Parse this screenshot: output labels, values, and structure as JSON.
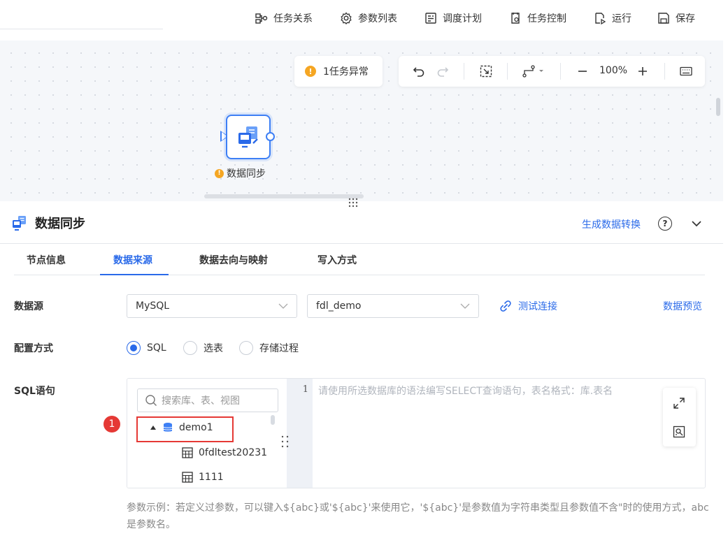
{
  "toolbar": {
    "items": [
      {
        "label": "任务关系",
        "icon": "relation-icon"
      },
      {
        "label": "参数列表",
        "icon": "gear-icon"
      },
      {
        "label": "调度计划",
        "icon": "schedule-icon"
      },
      {
        "label": "任务控制",
        "icon": "task-control-icon"
      },
      {
        "label": "运行",
        "icon": "run-icon"
      },
      {
        "label": "保存",
        "icon": "save-icon"
      }
    ]
  },
  "canvas": {
    "warning_text": "1任务异常",
    "zoom": "100%",
    "node": {
      "label": "数据同步",
      "status": "warning"
    }
  },
  "panel": {
    "title": "数据同步",
    "generate_link": "生成数据转换",
    "tabs": [
      "节点信息",
      "数据来源",
      "数据去向与映射",
      "写入方式"
    ],
    "active_tab": 1
  },
  "form": {
    "datasource_label": "数据源",
    "datasource_type": "MySQL",
    "datasource_conn": "fdl_demo",
    "test_link": "测试连接",
    "preview_link": "数据预览",
    "config_label": "配置方式",
    "config_options": [
      "SQL",
      "选表",
      "存储过程"
    ],
    "config_selected": 0,
    "sql_label": "SQL语句",
    "search_placeholder": "搜索库、表、视图",
    "tree": {
      "db": "demo1",
      "tables": [
        "0fdltest20231",
        "1111"
      ]
    },
    "line_number": "1",
    "code_placeholder": "请使用所选数据库的语法编写SELECT查询语句，表名格式：库.表名",
    "hint": "参数示例：若定义过参数，可以键入${abc}或'${abc}'来使用它，'${abc}'是参数值为字符串类型且参数值不含\"时的使用方式，abc是参数名。"
  },
  "annotation": {
    "badge": "1"
  },
  "colors": {
    "accent": "#2a6ae9",
    "warning": "#f5a623",
    "highlight": "#e53935"
  }
}
